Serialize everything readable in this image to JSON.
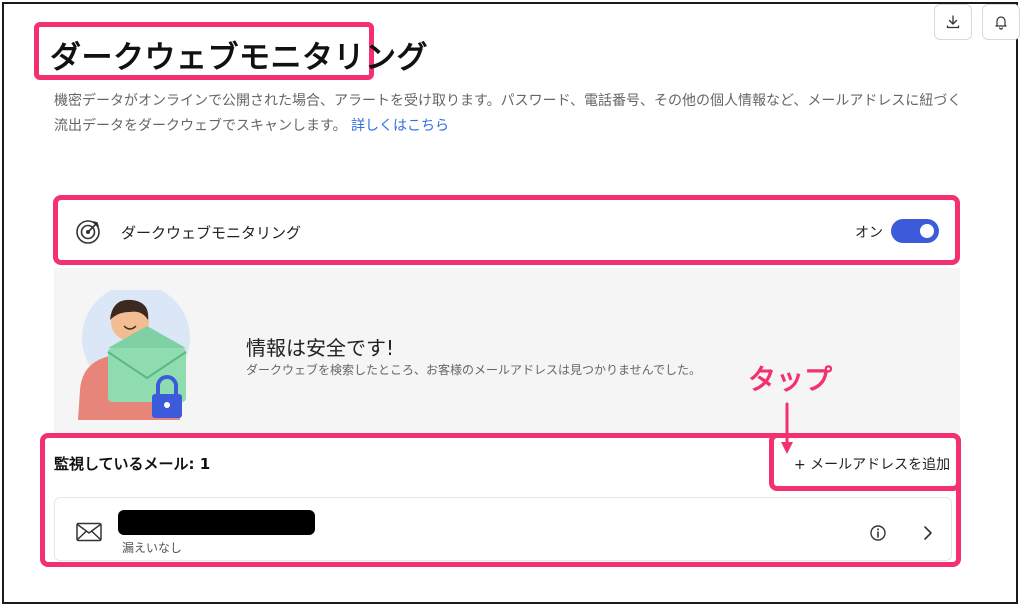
{
  "header": {
    "title": "ダークウェブモニタリング",
    "description": "機密データがオンラインで公開された場合、アラートを受け取ります。パスワード、電話番号、その他の個人情報など、メールアドレスに紐づく流出データをダークウェブでスキャンします。",
    "learn_more": "詳しくはこちら"
  },
  "toolbar": {
    "download_icon": "download-icon",
    "bell_icon": "bell-icon"
  },
  "monitoring": {
    "label": "ダークウェブモニタリング",
    "status_label": "オン",
    "enabled": true,
    "icon": "target-icon"
  },
  "status_panel": {
    "title": "情報は安全です!",
    "subtitle": "ダークウェブを検索したところ、お客様のメールアドレスは見つかりませんでした。"
  },
  "annotation": {
    "tap_label": "タップ"
  },
  "emails": {
    "heading": "監視しているメール: 1",
    "add_label": "+ メールアドレスを追加",
    "items": [
      {
        "status": "漏えいなし"
      }
    ]
  },
  "colors": {
    "accent": "#3b5bdb",
    "highlight": "#f2316e",
    "link": "#2f6fe0"
  }
}
